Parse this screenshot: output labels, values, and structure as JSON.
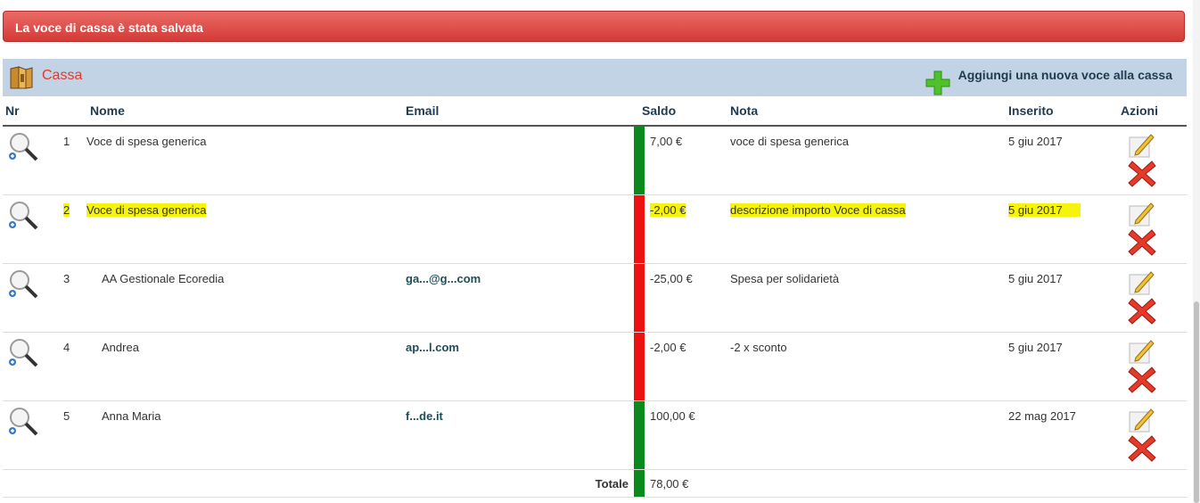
{
  "alert": {
    "message": "La voce di cassa è stata salvata"
  },
  "panel": {
    "title": "Cassa",
    "add_label": "Aggiungi una nuova voce alla cassa"
  },
  "table": {
    "headers": {
      "nr": "Nr",
      "nome": "Nome",
      "email": "Email",
      "saldo": "Saldo",
      "nota": "Nota",
      "inserito": "Inserito",
      "azioni": "Azioni"
    },
    "rows": [
      {
        "nr": "1",
        "nome": "Voce di spesa generica",
        "email": "",
        "saldo": "7,00 €",
        "nota": "voce di spesa generica",
        "inserito": "5 giu 2017",
        "status": "positive",
        "highlight": false
      },
      {
        "nr": "2",
        "nome": "Voce di spesa generica",
        "email": "",
        "saldo": "-2,00 €",
        "nota": "descrizione importo Voce di cassa",
        "inserito": "5 giu 2017",
        "status": "negative",
        "highlight": true
      },
      {
        "nr": "3",
        "nome": "AA Gestionale Ecoredia",
        "email": "ga...@g...com",
        "saldo": "-25,00 €",
        "nota": "Spesa per solidarietà",
        "inserito": "5 giu 2017",
        "status": "negative",
        "highlight": false
      },
      {
        "nr": "4",
        "nome": "Andrea",
        "email": "ap...l.com",
        "saldo": "-2,00 €",
        "nota": "-2 x sconto",
        "inserito": "5 giu 2017",
        "status": "negative",
        "highlight": false
      },
      {
        "nr": "5",
        "nome": "Anna Maria",
        "email": "f...de.it",
        "saldo": "100,00 €",
        "nota": "",
        "inserito": "22 mag 2017",
        "status": "positive",
        "highlight": false
      }
    ],
    "total_label": "Totale",
    "total_value": "78,00 €"
  },
  "colors": {
    "positive": "#0a8a1c",
    "negative": "#ee1111",
    "highlight": "#f5f40a",
    "alert": "#d9534f",
    "panel": "#c3d3e6",
    "title": "#e03a2f"
  },
  "icons": {
    "view": "magnifier-icon",
    "edit": "pencil-icon",
    "delete": "delete-x-icon",
    "add": "plus-icon",
    "cash": "cash-book-icon"
  }
}
